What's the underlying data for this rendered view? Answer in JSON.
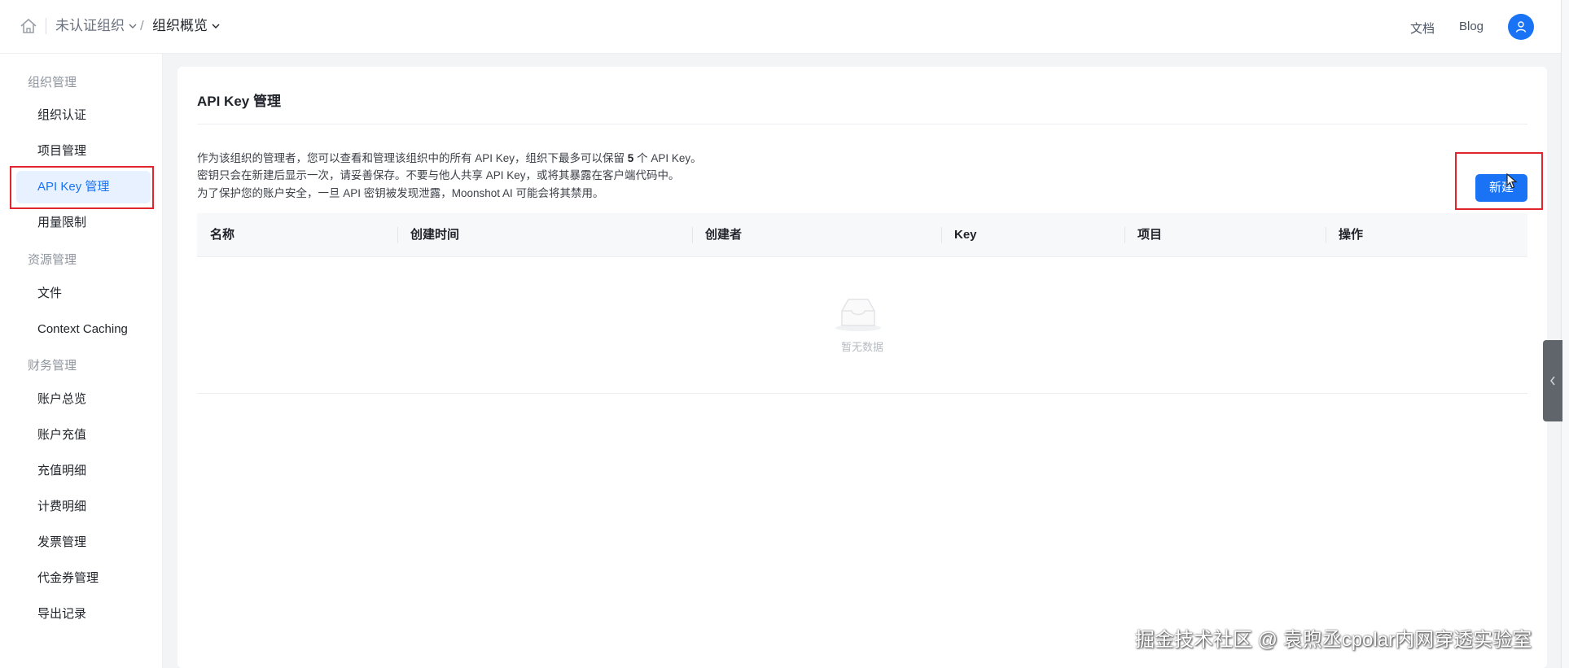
{
  "header": {
    "org_breadcrumb": "未认证组织",
    "separator": "/",
    "page_breadcrumb": "组织概览",
    "docs_label": "文档",
    "blog_label": "Blog",
    "home_icon": "home-icon",
    "avatar_icon": "user-icon"
  },
  "sidebar": {
    "groups": [
      {
        "title": "组织管理",
        "items": [
          "组织认证",
          "项目管理",
          "API Key 管理",
          "用量限制"
        ]
      },
      {
        "title": "资源管理",
        "items": [
          "文件",
          "Context Caching"
        ]
      },
      {
        "title": "财务管理",
        "items": [
          "账户总览",
          "账户充值",
          "充值明细",
          "计费明细",
          "发票管理",
          "代金券管理",
          "导出记录"
        ]
      }
    ],
    "active_item": "API Key 管理"
  },
  "main": {
    "title": "API Key 管理",
    "desc_line1_prefix": "作为该组织的管理者，您可以查看和管理该组织中的所有 API Key，组织下最多可以保留",
    "desc_line1_count": "5",
    "desc_line1_suffix": "个 API Key。",
    "desc_line2": "密钥只会在新建后显示一次，请妥善保存。不要与他人共享 API Key，或将其暴露在客户端代码中。",
    "desc_line3": "为了保护您的账户安全，一旦 API 密钥被发现泄露，Moonshot AI 可能会将其禁用。",
    "new_button_label": "新建",
    "table": {
      "columns": [
        "名称",
        "创建时间",
        "创建者",
        "Key",
        "项目",
        "操作"
      ],
      "rows": [],
      "empty_text": "暂无数据"
    }
  },
  "watermark": "掘金技术社区 @ 袁煦丞cpolar内网穿透实验室",
  "colors": {
    "accent": "#1a73f5",
    "highlight_box": "#e0262c",
    "active_bg": "#e8f1ff"
  }
}
